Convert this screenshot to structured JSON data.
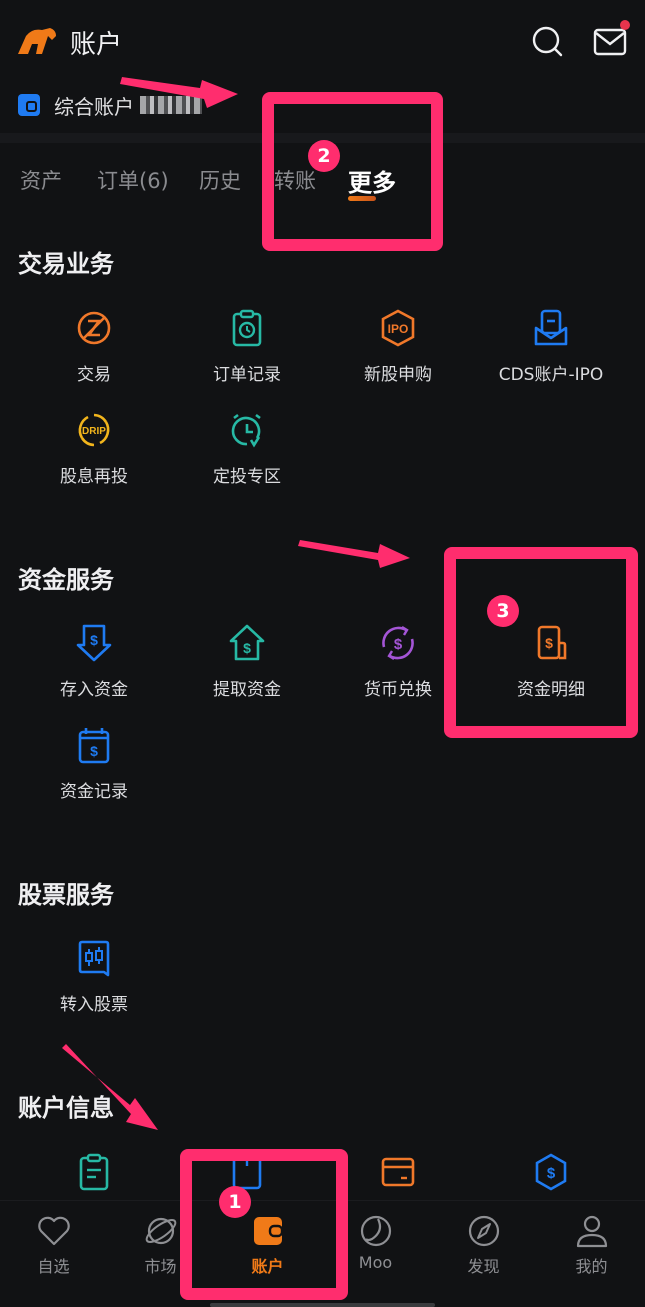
{
  "header": {
    "title": "账户",
    "logo": "bull-logo-icon",
    "search_icon": "search-icon",
    "mail_icon": "mail-icon",
    "mail_has_notification": true
  },
  "account": {
    "label": "综合账户",
    "number_masked": true,
    "icon": "wallet-icon"
  },
  "tabs": [
    {
      "label": "资产",
      "active": false
    },
    {
      "label": "订单(6)",
      "active": false
    },
    {
      "label": "历史",
      "active": false
    },
    {
      "label": "转账",
      "active": false
    },
    {
      "label": "更多",
      "active": true
    }
  ],
  "sections": {
    "trading": {
      "title": "交易业务",
      "items": [
        {
          "label": "交易",
          "icon": "trade-icon",
          "color": "#f0782a"
        },
        {
          "label": "订单记录",
          "icon": "order-record-icon",
          "color": "#27b9a5"
        },
        {
          "label": "新股申购",
          "icon": "ipo-icon",
          "color": "#f0782a"
        },
        {
          "label": "CDS账户-IPO",
          "icon": "cds-account-icon",
          "color": "#1f7bf2"
        },
        {
          "label": "股息再投",
          "icon": "drip-icon",
          "color": "#f2b51c"
        },
        {
          "label": "定投专区",
          "icon": "alarm-clock-icon",
          "color": "#27b9a5"
        }
      ]
    },
    "funds": {
      "title": "资金服务",
      "items": [
        {
          "label": "存入资金",
          "icon": "deposit-icon",
          "color": "#1f7bf2"
        },
        {
          "label": "提取资金",
          "icon": "withdraw-icon",
          "color": "#27b9a5"
        },
        {
          "label": "货币兑换",
          "icon": "currency-exchange-icon",
          "color": "#a455d6"
        },
        {
          "label": "资金明细",
          "icon": "fund-details-icon",
          "color": "#f0782a"
        },
        {
          "label": "资金记录",
          "icon": "fund-record-icon",
          "color": "#1f7bf2"
        }
      ]
    },
    "stocks": {
      "title": "股票服务",
      "items": [
        {
          "label": "转入股票",
          "icon": "transfer-in-stock-icon",
          "color": "#1f7bf2"
        }
      ]
    },
    "account_info": {
      "title": "账户信息",
      "items": [
        {
          "icon": "clipboard-icon",
          "color": "#27b9a5"
        },
        {
          "icon": "box-icon",
          "color": "#1f7bf2"
        },
        {
          "icon": "card-icon",
          "color": "#f0782a"
        },
        {
          "icon": "dollar-shield-icon",
          "color": "#1f7bf2"
        }
      ]
    }
  },
  "bottom_nav": [
    {
      "label": "自选",
      "icon": "heart-icon",
      "active": false
    },
    {
      "label": "市场",
      "icon": "planet-icon",
      "active": false
    },
    {
      "label": "账户",
      "icon": "wallet-icon",
      "active": true
    },
    {
      "label": "Moo",
      "icon": "moo-icon",
      "active": false
    },
    {
      "label": "发现",
      "icon": "compass-icon",
      "active": false
    },
    {
      "label": "我的",
      "icon": "person-icon",
      "active": false
    }
  ],
  "annotations": [
    {
      "number": "1",
      "target": "bottom-nav 账户"
    },
    {
      "number": "2",
      "target": "tab 更多"
    },
    {
      "number": "3",
      "target": "资金明细"
    }
  ],
  "colors": {
    "background": "#111214",
    "accent": "#f07a18",
    "annotation": "#ff2d6e"
  }
}
